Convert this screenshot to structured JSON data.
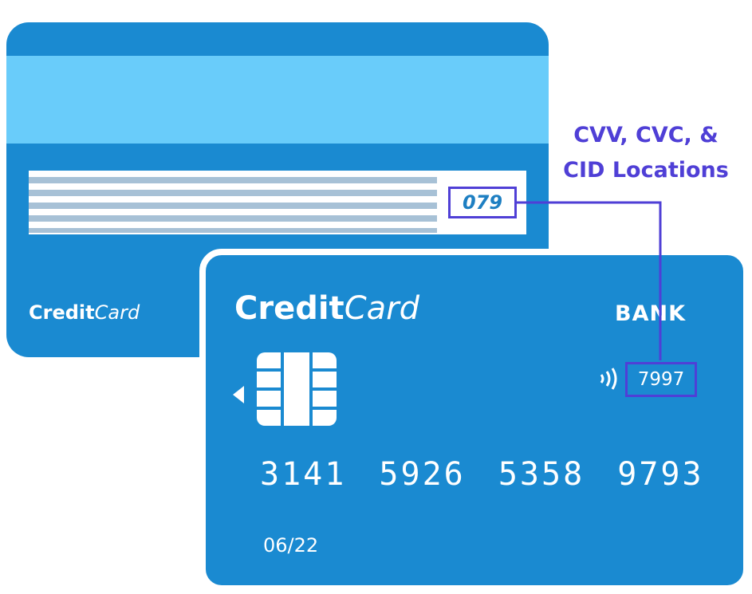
{
  "back_card": {
    "brand_bold": "Credit",
    "brand_italic": "Card",
    "cvv": "079",
    "color": "#1a8ad1",
    "stripe_color": "#69ccfa"
  },
  "front_card": {
    "brand_bold": "Credit",
    "brand_italic": "Card",
    "bank": "BANK",
    "cid": "7997",
    "number": "3141 5926 5358 9793",
    "expiry": "06/22",
    "color": "#1a8ad1"
  },
  "callout": {
    "line1": "CVV, CVC, &",
    "line2": "CID Locations",
    "color": "#4f3fd6"
  },
  "icons": [
    "chip-icon",
    "chip-arrow-icon",
    "contactless-icon"
  ]
}
